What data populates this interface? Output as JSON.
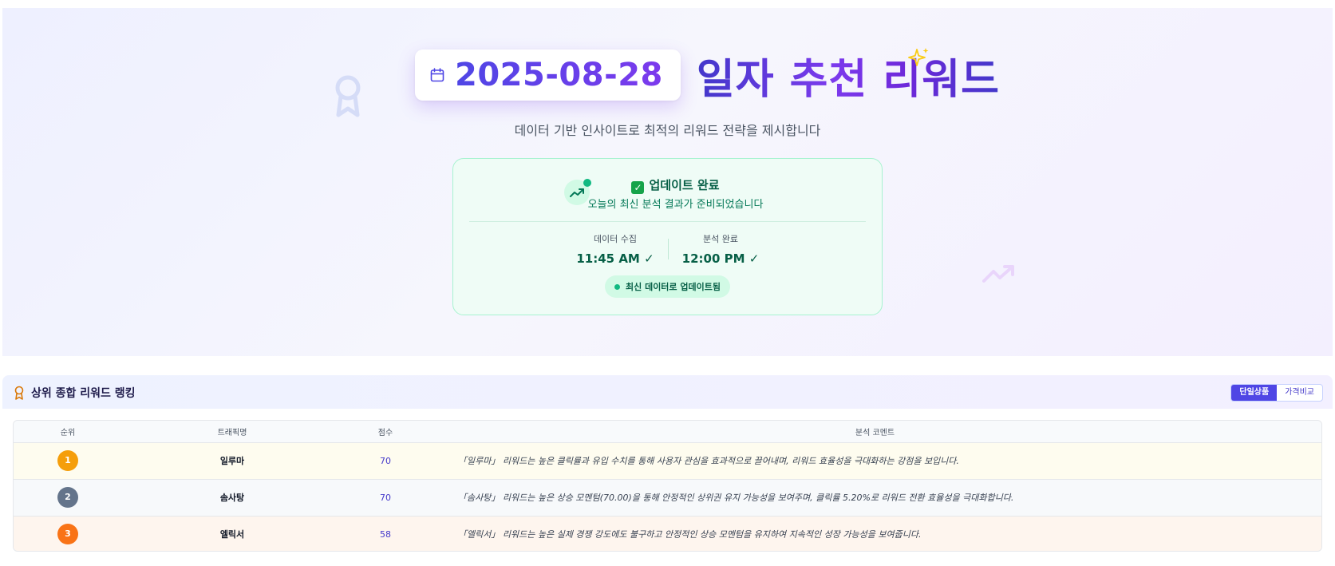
{
  "hero": {
    "date": "2025-08-28",
    "title": "일자 추천 리워드",
    "subtitle": "데이터 기반 인사이트로 최적의 리워드 전략을 제시합니다"
  },
  "status": {
    "title": "업데이트 완료",
    "description": "오늘의 최신 분석 결과가 준비되었습니다",
    "collect_label": "데이터 수집",
    "collect_time": "11:45 AM ✓",
    "analysis_label": "분석 완료",
    "analysis_time": "12:00 PM ✓",
    "pill": "최신 데이터로 업데이트됨"
  },
  "ranking": {
    "title": "상위 종합 리워드 랭킹",
    "toggle": [
      "단일상품",
      "가격비교"
    ],
    "toggle_selected": "단일상품",
    "columns": [
      "순위",
      "트래픽명",
      "점수",
      "분석 코멘트"
    ],
    "rows": [
      {
        "rank": "1",
        "name": "일루마",
        "score": "70",
        "comment": "「일루마」 리워드는 높은 클릭률과 유입 수치를 통해 사용자 관심을 효과적으로 끌어내며, 리워드 효율성을 극대화하는 강점을 보입니다."
      },
      {
        "rank": "2",
        "name": "솜사탕",
        "score": "70",
        "comment": "「솜사탕」 리워드는 높은 상승 모멘텀(70.00)을 통해 안정적인 상위권 유지 가능성을 보여주며, 클릭률 5.20%로 리워드 전환 효율성을 극대화합니다."
      },
      {
        "rank": "3",
        "name": "엘릭서",
        "score": "58",
        "comment": "「엘릭서」 리워드는 높은 실제 경쟁 강도에도 불구하고 안정적인 상승 모멘텀을 유지하여 지속적인 성장 가능성을 보여줍니다."
      }
    ]
  },
  "icons": {
    "date": "calendar-icon",
    "sparkle": "sparkle-icon",
    "status": "trending-up-icon",
    "ranking": "award-icon"
  },
  "colors": {
    "accent": "#4f46e5",
    "accent_purple": "#7c3aed",
    "success": "#10b981",
    "gold": "#f59e0b",
    "silver": "#64748b",
    "bronze": "#f97316"
  }
}
